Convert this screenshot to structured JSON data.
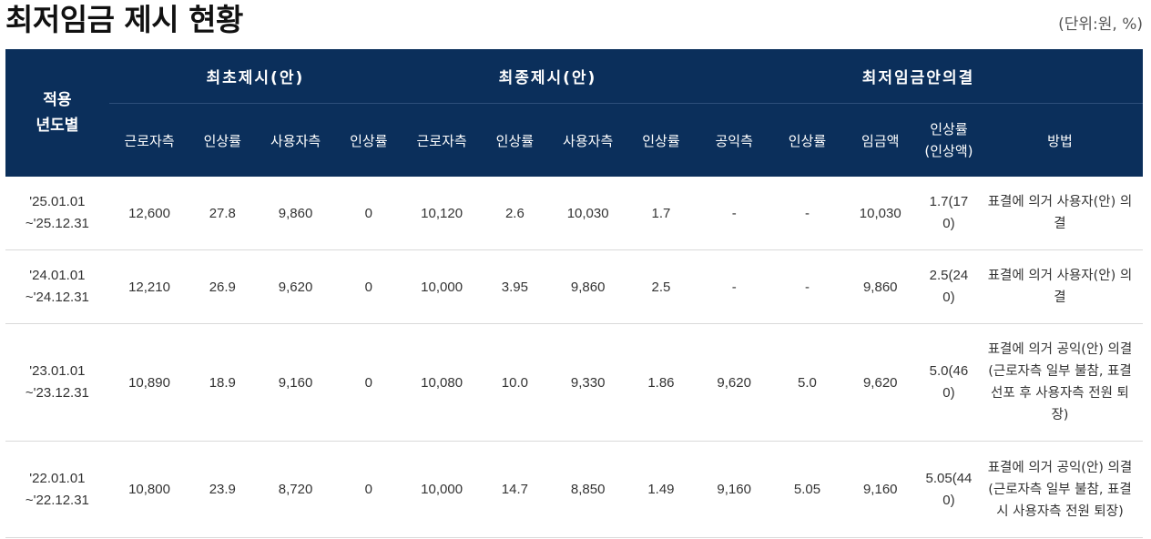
{
  "title": "최저임금 제시 현황",
  "unit": "(단위:원, %)",
  "header": {
    "year": [
      "적용",
      "년도별"
    ],
    "groups": [
      "최초제시(안)",
      "최종제시(안)",
      "최저임금안의결"
    ],
    "sub": [
      "근로자측",
      "인상률",
      "사용자측",
      "인상률",
      "근로자측",
      "인상률",
      "사용자측",
      "인상률",
      "공익측",
      "인상률",
      "임금액"
    ],
    "rate_col": [
      "인상률",
      "(인상액)"
    ],
    "method_col": "방법"
  },
  "rows": [
    {
      "period": [
        "'25.01.01",
        "~'25.12.31"
      ],
      "cells": [
        "12,600",
        "27.8",
        "9,860",
        "0",
        "10,120",
        "2.6",
        "10,030",
        "1.7",
        "-",
        "-",
        "10,030"
      ],
      "rate": [
        "1.7(17",
        "0)"
      ],
      "method": [
        "표결에 의거 사용자(안) 의",
        "결"
      ]
    },
    {
      "period": [
        "'24.01.01",
        "~'24.12.31"
      ],
      "cells": [
        "12,210",
        "26.9",
        "9,620",
        "0",
        "10,000",
        "3.95",
        "9,860",
        "2.5",
        "-",
        "-",
        "9,860"
      ],
      "rate": [
        "2.5(24",
        "0)"
      ],
      "method": [
        "표결에 의거 사용자(안) 의",
        "결"
      ]
    },
    {
      "period": [
        "'23.01.01",
        "~'23.12.31"
      ],
      "cells": [
        "10,890",
        "18.9",
        "9,160",
        "0",
        "10,080",
        "10.0",
        "9,330",
        "1.86",
        "9,620",
        "5.0",
        "9,620"
      ],
      "rate": [
        "5.0(46",
        "0)"
      ],
      "method": [
        "표결에 의거 공익(안) 의결",
        "(근로자측 일부 불참, 표결",
        "선포 후 사용자측 전원 퇴",
        "장)"
      ]
    },
    {
      "period": [
        "'22.01.01",
        "~'22.12.31"
      ],
      "cells": [
        "10,800",
        "23.9",
        "8,720",
        "0",
        "10,000",
        "14.7",
        "8,850",
        "1.49",
        "9,160",
        "5.05",
        "9,160"
      ],
      "rate": [
        "5.05(44",
        "0)"
      ],
      "method": [
        "표결에 의거 공익(안) 의결",
        "(근로자측 일부 불참, 표결",
        "시 사용자측 전원 퇴장)"
      ]
    }
  ]
}
